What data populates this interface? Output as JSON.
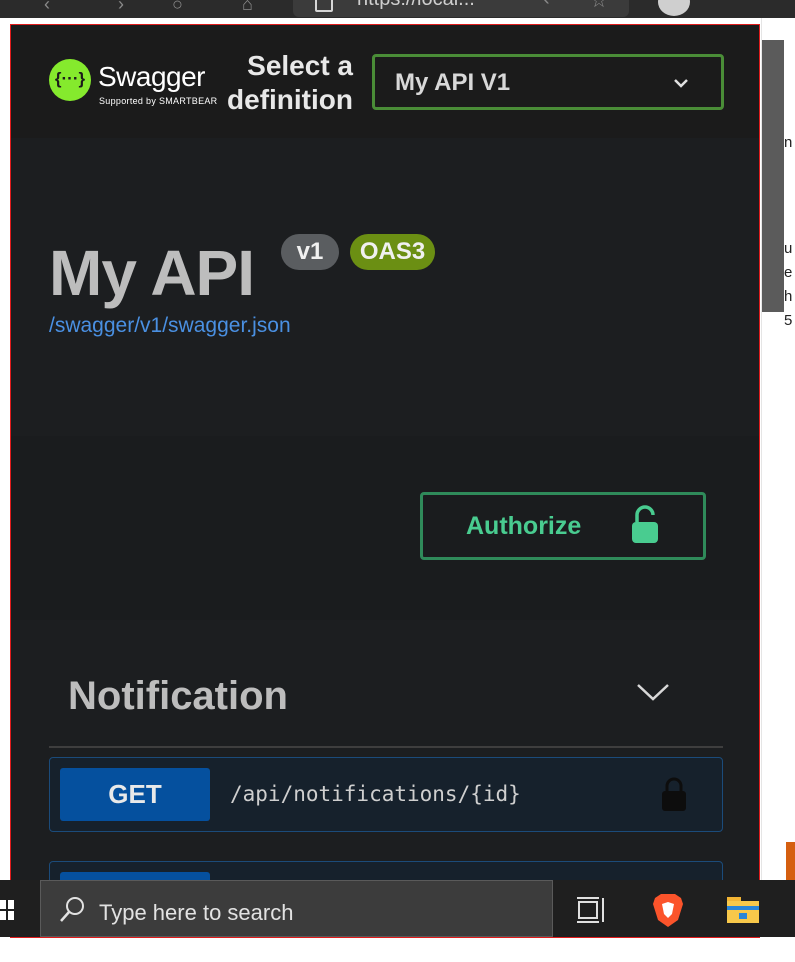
{
  "browser": {
    "url": "https://local..."
  },
  "swagger": {
    "logo": {
      "name": "Swagger",
      "sub": "Supported by SMARTBEAR",
      "icon": "swagger-logo-icon"
    },
    "definition": {
      "label": "Select a definition",
      "selected": "My API V1"
    },
    "api": {
      "title": "My API",
      "version_badge": "v1",
      "oas_badge": "OAS3",
      "spec_link": "/swagger/v1/swagger.json"
    },
    "authorize": {
      "label": "Authorize",
      "icon": "unlock-icon"
    },
    "tag": {
      "title": "Notification"
    },
    "operations": [
      {
        "method": "GET",
        "path": "/api/notifications/{id}"
      }
    ]
  },
  "taskbar": {
    "search_placeholder": "Type here to search"
  },
  "colors": {
    "swagger_green": "#85ea2d",
    "get_blue": "#05509e",
    "authorize_green": "#49cc90",
    "oas_badge": "#6b8f13",
    "link_blue": "#4a90e2",
    "frame_border": "#e01b1b"
  }
}
